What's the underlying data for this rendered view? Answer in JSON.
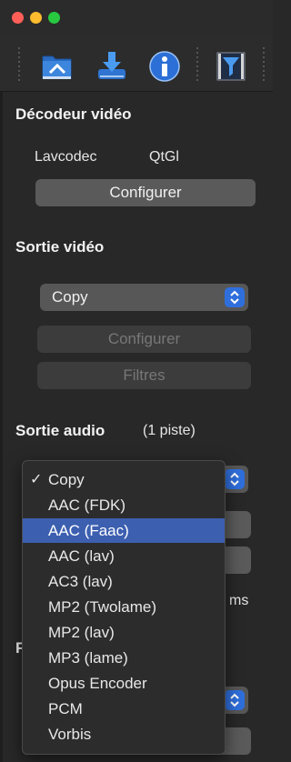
{
  "toolbar": {
    "icons": [
      "folder-open-icon",
      "download-icon",
      "info-icon",
      "filter-icon"
    ]
  },
  "video_decoder": {
    "title": "Décodeur vidéo",
    "decoder": "Lavcodec",
    "renderer": "QtGl",
    "configure_label": "Configurer"
  },
  "video_output": {
    "title": "Sortie vidéo",
    "codec": "Copy",
    "configure_label": "Configurer",
    "filters_label": "Filtres"
  },
  "audio_output": {
    "title": "Sortie audio",
    "tracks": "(1 piste)",
    "ms_suffix": "ms",
    "section_initial": "F"
  },
  "audio_codec_menu": {
    "checked_index": 0,
    "highlighted_index": 2,
    "checkmark": "✓",
    "items": [
      "Copy",
      "AAC (FDK)",
      "AAC (Faac)",
      "AAC (lav)",
      "AC3 (lav)",
      "MP2 (Twolame)",
      "MP2 (lav)",
      "MP3 (lame)",
      "Opus Encoder",
      "PCM",
      "Vorbis"
    ]
  },
  "colors": {
    "accent": "#2f6fdc",
    "highlight": "#3c5fb0",
    "close": "#ff5f57",
    "minimize": "#febc2e",
    "zoom": "#28c840"
  }
}
